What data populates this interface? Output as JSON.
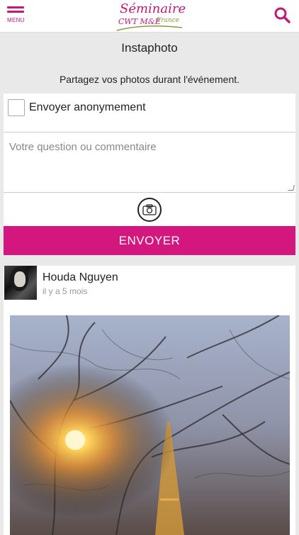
{
  "header": {
    "menu_label": "MENU",
    "logo_line1": "Séminaire",
    "logo_line2": "CWT M&E",
    "logo_line3": "France"
  },
  "page": {
    "title": "Instaphoto",
    "subtitle": "Partagez vos photos durant l'événement."
  },
  "form": {
    "anonymous_label": "Envoyer anonymement",
    "anonymous_checked": false,
    "comment_placeholder": "Votre question ou commentaire",
    "comment_value": "",
    "send_label": "ENVOYER"
  },
  "post": {
    "author": "Houda Nguyen",
    "timestamp": "il y a 5 mois"
  },
  "colors": {
    "accent": "#d4177f",
    "background": "#e9e9e9"
  }
}
